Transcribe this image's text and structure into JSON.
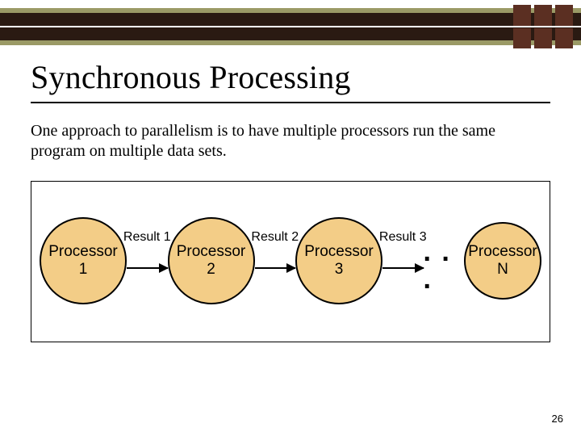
{
  "title": "Synchronous Processing",
  "body": "One approach to parallelism is to have multiple processors run the same program on multiple data sets.",
  "diagram": {
    "node_word": "Processor",
    "nodes": [
      "1",
      "2",
      "3",
      "N"
    ],
    "links": [
      "Result 1",
      "Result 2",
      "Result 3"
    ],
    "ellipsis": ". . ."
  },
  "page_number": "26"
}
